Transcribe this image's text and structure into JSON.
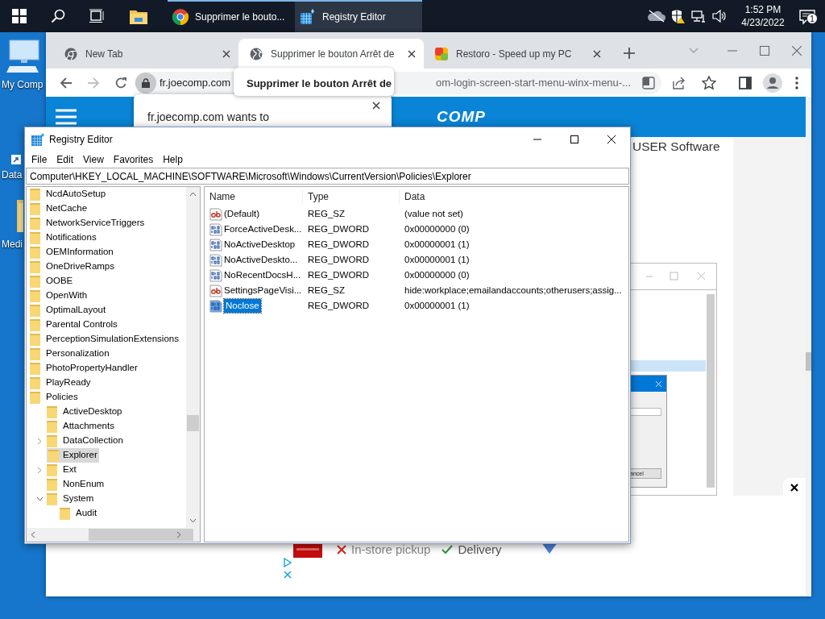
{
  "taskbar": {
    "apps": [
      {
        "kind": "explorer",
        "selected": false
      },
      {
        "kind": "chrome",
        "label": "Supprimer le bouto...",
        "selected": false
      },
      {
        "kind": "regedit",
        "label": "Registry Editor",
        "selected": true
      }
    ],
    "clock": {
      "time": "1:52 PM",
      "date": "4/23/2022"
    },
    "notification_count": "1"
  },
  "desktop_icons": [
    {
      "kind": "computer",
      "label": "My Comp"
    },
    {
      "kind": "shortcut",
      "label": "Data"
    },
    {
      "kind": "folder",
      "label": "Medi"
    }
  ],
  "browser": {
    "tabs": [
      {
        "kind": "chrome",
        "label": "New Tab",
        "selected": false
      },
      {
        "kind": "globe",
        "label": "Supprimer le bouton Arrêt de",
        "selected": true
      },
      {
        "kind": "restoro",
        "label": "Restoro - Speed up my PC",
        "selected": false
      }
    ],
    "address": {
      "host": "fr.joecomp.com",
      "path": "om-login-screen-start-menu-winx-menu-..."
    },
    "tab_tooltip": "Supprimer le bouton Arrêt de",
    "permission_popup": {
      "text": "fr.joecomp.com wants to"
    },
    "page": {
      "logo": "COMP",
      "heading": "USER Software",
      "embedded_button": "ancel",
      "ad": {
        "items": [
          {
            "label": "In-store pickup",
            "available": false
          },
          {
            "label": "Delivery",
            "available": true
          }
        ]
      }
    }
  },
  "registry_editor": {
    "title": "Registry Editor",
    "menu": [
      "File",
      "Edit",
      "View",
      "Favorites",
      "Help"
    ],
    "address": "Computer\\HKEY_LOCAL_MACHINE\\SOFTWARE\\Microsoft\\Windows\\CurrentVersion\\Policies\\Explorer",
    "tree": [
      {
        "label": "NcdAutoSetup",
        "selected": false
      },
      {
        "label": "NetCache",
        "selected": false
      },
      {
        "label": "NetworkServiceTriggers",
        "selected": false
      },
      {
        "label": "Notifications",
        "selected": false
      },
      {
        "label": "OEMInformation",
        "selected": false
      },
      {
        "label": "OneDriveRamps",
        "selected": false
      },
      {
        "label": "OOBE",
        "selected": false
      },
      {
        "label": "OpenWith",
        "selected": false
      },
      {
        "label": "OptimalLayout",
        "selected": false
      },
      {
        "label": "Parental Controls",
        "selected": false
      },
      {
        "label": "PerceptionSimulationExtensions",
        "selected": false
      },
      {
        "label": "Personalization",
        "selected": false
      },
      {
        "label": "PhotoPropertyHandler",
        "selected": false
      },
      {
        "label": "PlayReady",
        "selected": false
      },
      {
        "label": "Policies",
        "selected": false,
        "children": [
          {
            "label": "ActiveDesktop",
            "selected": false
          },
          {
            "label": "Attachments",
            "selected": false
          },
          {
            "label": "DataCollection",
            "selected": false,
            "expanded": false
          },
          {
            "label": "Explorer",
            "selected": true
          },
          {
            "label": "Ext",
            "selected": false,
            "expanded": false
          },
          {
            "label": "NonEnum",
            "selected": false
          },
          {
            "label": "System",
            "selected": false,
            "expanded": true,
            "children": [
              {
                "label": "Audit",
                "selected": false
              }
            ]
          }
        ]
      }
    ],
    "columns": [
      "Name",
      "Type",
      "Data"
    ],
    "rows": [
      {
        "kind": "string",
        "name": "(Default)",
        "type": "REG_SZ",
        "data": "(value not set)",
        "selected": false
      },
      {
        "kind": "dword",
        "name": "ForceActiveDesk...",
        "type": "REG_DWORD",
        "data": "0x00000000 (0)",
        "selected": false
      },
      {
        "kind": "dword",
        "name": "NoActiveDesktop",
        "type": "REG_DWORD",
        "data": "0x00000001 (1)",
        "selected": false
      },
      {
        "kind": "dword",
        "name": "NoActiveDeskto...",
        "type": "REG_DWORD",
        "data": "0x00000001 (1)",
        "selected": false
      },
      {
        "kind": "dword",
        "name": "NoRecentDocsH...",
        "type": "REG_DWORD",
        "data": "0x00000000 (0)",
        "selected": false
      },
      {
        "kind": "string",
        "name": "SettingsPageVisi...",
        "type": "REG_SZ",
        "data": "hide:workplace;emailandaccounts;otherusers;assig...",
        "selected": false
      },
      {
        "kind": "dword",
        "name": "Noclose",
        "type": "REG_DWORD",
        "data": "0x00000001 (1)",
        "selected": true
      }
    ]
  }
}
